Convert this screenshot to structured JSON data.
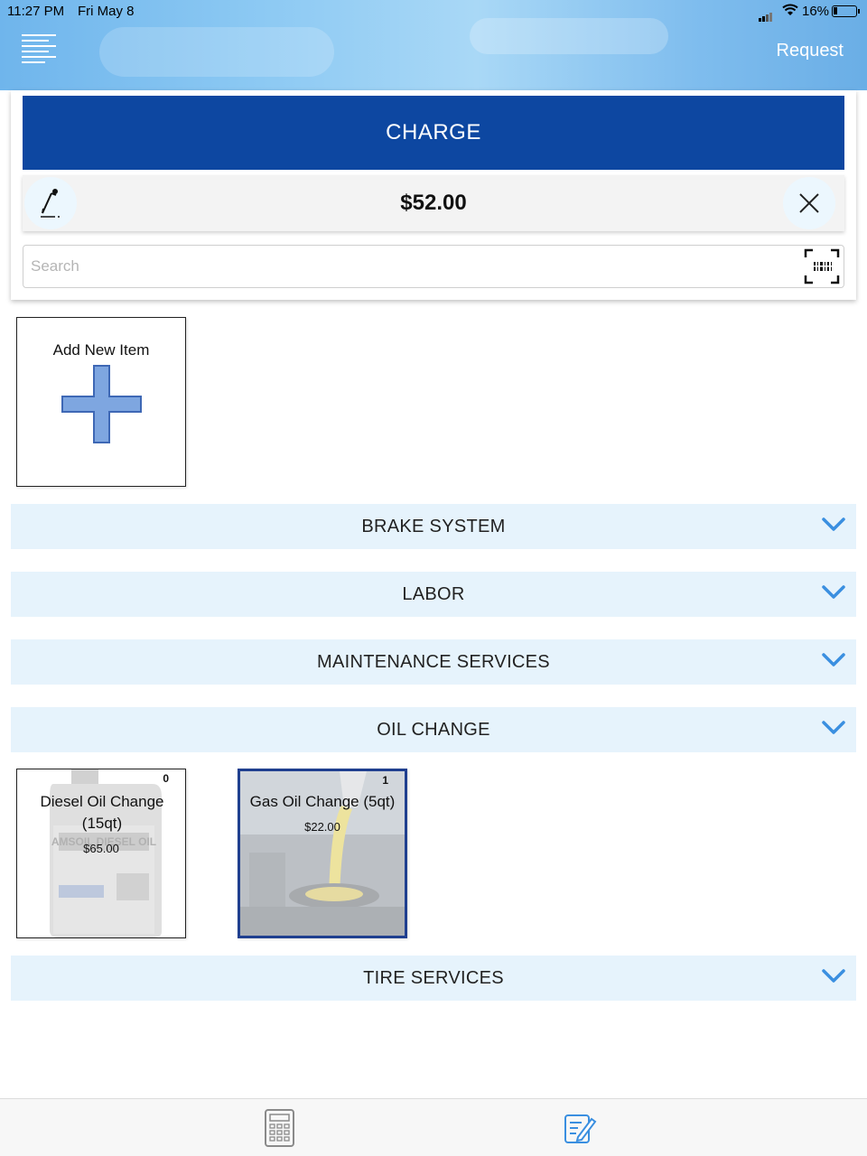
{
  "status_bar": {
    "time": "11:27 PM",
    "date": "Fri May 8",
    "battery": "16%"
  },
  "header": {
    "menu_icon": "menu-lines-icon",
    "request_label": "Request"
  },
  "charge": {
    "label": "CHARGE",
    "amount": "$52.00",
    "edit_icon": "pen-icon",
    "clear_icon": "close-icon"
  },
  "search": {
    "placeholder": "Search",
    "value": "",
    "scan_icon": "barcode-scan-icon"
  },
  "add_item": {
    "label": "Add New Item",
    "icon": "plus-icon",
    "icon_color": "#7ea6e0"
  },
  "categories": [
    {
      "title": "BRAKE SYSTEM"
    },
    {
      "title": "LABOR"
    },
    {
      "title": "MAINTENANCE SERVICES"
    },
    {
      "title": "OIL CHANGE"
    },
    {
      "title": "TIRE SERVICES"
    }
  ],
  "oil_change_items": [
    {
      "name": "Diesel Oil Change (15qt)",
      "price": "$65.00",
      "count": "0",
      "image": "diesel-oil-jug-image",
      "image_text": "AMSOIL DIESEL OIL",
      "selected": false
    },
    {
      "name": "Gas Oil Change (5qt)",
      "price": "$22.00",
      "count": "1",
      "image": "oil-pour-image",
      "selected": true
    }
  ],
  "bottom_tabs": [
    {
      "icon": "calculator-icon"
    },
    {
      "icon": "edit-list-icon"
    }
  ],
  "colors": {
    "accent": "#0d47a1",
    "category_bg": "#e6f3fc",
    "chevron": "#3a8fe0",
    "selected_border": "#1f3f8f"
  }
}
